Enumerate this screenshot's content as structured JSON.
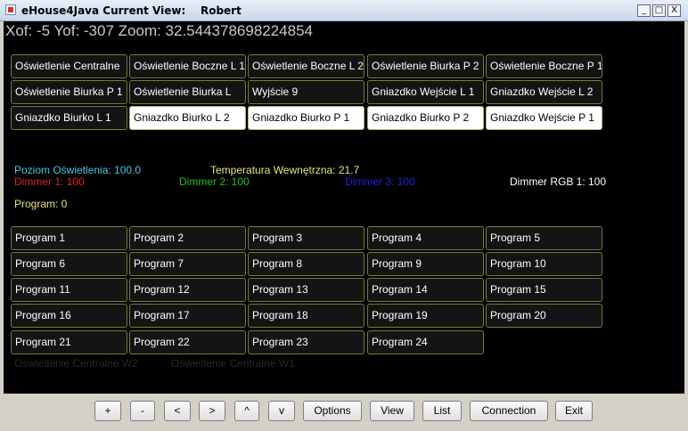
{
  "window": {
    "title": "eHouse4Java Current View:    Robert",
    "minimize_glyph": "_",
    "maximize_glyph": "□",
    "close_glyph": "X"
  },
  "status": {
    "coords": "Xof: -5 Yof: -307 Zoom: 32.544378698224854"
  },
  "outputs": [
    {
      "label": "Oświetlenie Centralne",
      "on": false
    },
    {
      "label": "Oświetlenie Boczne L 1",
      "on": false
    },
    {
      "label": "Oświetlenie Boczne L 2",
      "on": false
    },
    {
      "label": "Oświetlenie Biurka P 2",
      "on": false
    },
    {
      "label": "Oświetlenie Boczne P 1",
      "on": false
    },
    {
      "label": "Oświetlenie Biurka P 1",
      "on": false
    },
    {
      "label": "Oświetlenie Biurka L",
      "on": false
    },
    {
      "label": "Wyjście 9",
      "on": false
    },
    {
      "label": "Gniazdko Wejście L 1",
      "on": false
    },
    {
      "label": "Gniazdko Wejście L 2",
      "on": false
    },
    {
      "label": "Gniazdko Biurko L 1",
      "on": false
    },
    {
      "label": "Gniazdko Biurko L 2",
      "on": true
    },
    {
      "label": "Gniazdko Biurko P 1",
      "on": true
    },
    {
      "label": "Gniazdko Biurko P 2",
      "on": true
    },
    {
      "label": "Gniazdko Wejście P 1",
      "on": true
    }
  ],
  "readings": {
    "light_level": "Poziom Oświetlenia: 100.0",
    "temperature": "Temperatura Wewnętrzna: 21.7",
    "dimmer1": "Dimmer 1: 100",
    "dimmer2": "Dimmer 2: 100",
    "dimmer3": "Dimmer 3: 100",
    "dimmer_rgb": "Dimmer RGB 1: 100",
    "program": "Program: 0"
  },
  "colors": {
    "light_level": "#44c8e0",
    "temperature": "#e6e67a",
    "dimmer1": "#e02020",
    "dimmer2": "#20c020",
    "dimmer3": "#2020d8",
    "dimmer_rgb": "#ffffff",
    "program": "#e6e67a",
    "faint": "#2a2a2a"
  },
  "programs": [
    "Program 1",
    "Program 2",
    "Program 3",
    "Program 4",
    "Program 5",
    "Program 6",
    "Program 7",
    "Program 8",
    "Program 9",
    "Program 10",
    "Program 11",
    "Program 12",
    "Program 13",
    "Program 14",
    "Program 15",
    "Program 16",
    "Program 17",
    "Program 18",
    "Program 19",
    "Program 20",
    "Program 21",
    "Program 22",
    "Program 23",
    "Program 24"
  ],
  "faint_labels": [
    "Oświetlenie Centralne W2",
    "Oświetlenie Centralne W1"
  ],
  "toolbar": {
    "plus": "+",
    "minus": "-",
    "left": "<",
    "right": ">",
    "up": "^",
    "down": "v",
    "options": "Options",
    "view": "View",
    "list": "List",
    "connection": "Connection",
    "exit": "Exit"
  }
}
